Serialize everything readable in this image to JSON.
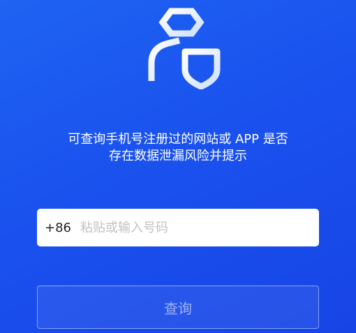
{
  "logo": {
    "icon": "shield-person-logo-icon"
  },
  "description": {
    "line1": "可查询手机号注册过的网站或 APP 是否",
    "line2": "存在数据泄漏风险并提示"
  },
  "phone": {
    "country_code": "+86",
    "placeholder": "粘贴或输入号码",
    "value": ""
  },
  "query_button": {
    "label": "查询"
  },
  "colors": {
    "background": "#1a52ee",
    "field_background": "#ffffff",
    "placeholder": "#c2c2c2"
  }
}
